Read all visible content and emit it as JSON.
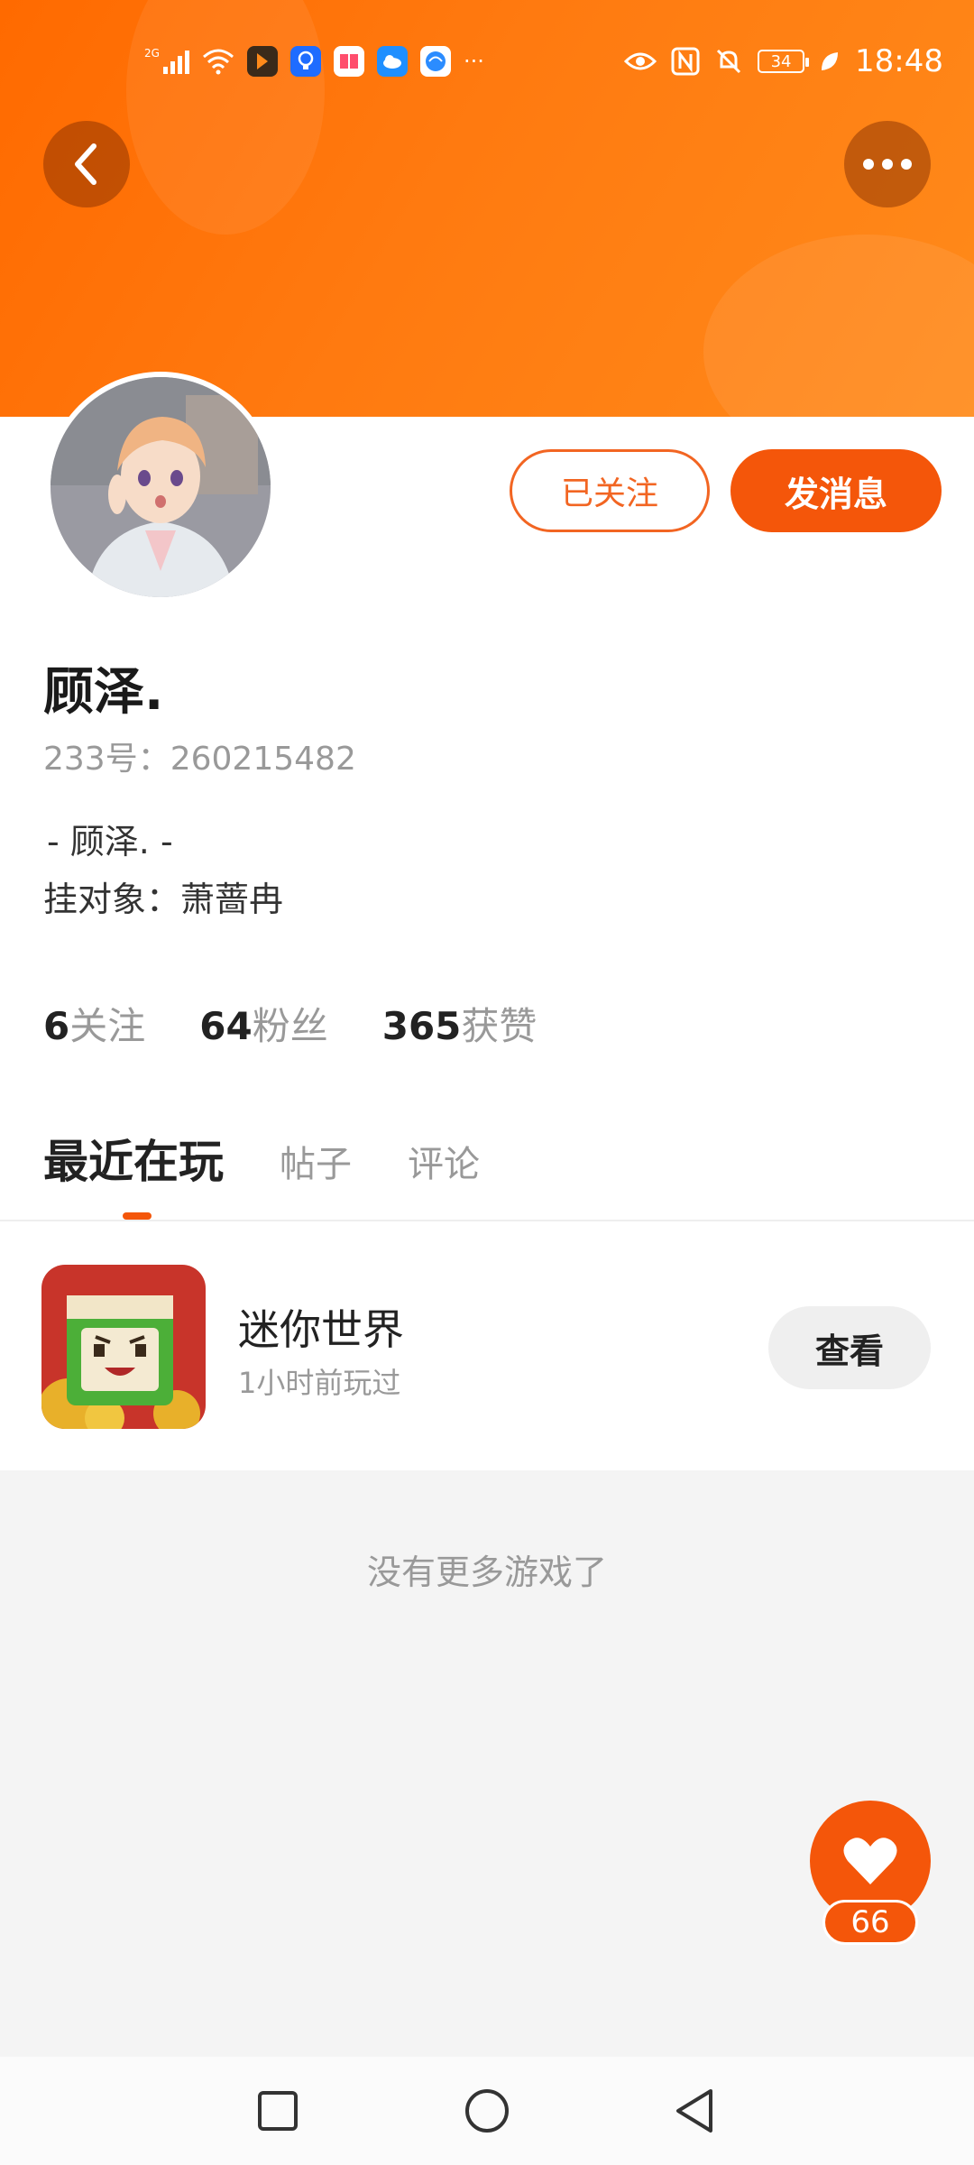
{
  "status_bar": {
    "network": "2G",
    "more_indicator": "···",
    "battery": "34",
    "time": "18:48",
    "icons": [
      "signal-icon",
      "wifi-icon",
      "app-notification-icon",
      "eye-icon",
      "nfc-icon",
      "mute-icon",
      "battery-icon",
      "leaf-icon"
    ]
  },
  "header": {
    "back_icon": "chevron-left-icon",
    "more_icon": "ellipsis-icon",
    "accent": "#ff6a00"
  },
  "profile": {
    "followed_label": "已关注",
    "message_label": "发消息",
    "nickname": "顾泽.",
    "uid": "233号：260215482",
    "bio_line1": "- 顾泽. -",
    "bio_line2": "挂对象：萧蔷冉"
  },
  "stats": [
    {
      "num": "6",
      "label": "关注"
    },
    {
      "num": "64",
      "label": "粉丝"
    },
    {
      "num": "365",
      "label": "获赞"
    }
  ],
  "tabs": [
    {
      "label": "最近在玩",
      "active": true
    },
    {
      "label": "帖子",
      "active": false
    },
    {
      "label": "评论",
      "active": false
    }
  ],
  "games": [
    {
      "name": "迷你世界",
      "time": "1小时前玩过",
      "action": "查看"
    }
  ],
  "list_end_text": "没有更多游戏了",
  "like": {
    "count": "66",
    "icon": "heart-icon"
  },
  "nav": {
    "icons": [
      "square-icon",
      "circle-icon",
      "triangle-back-icon"
    ]
  }
}
